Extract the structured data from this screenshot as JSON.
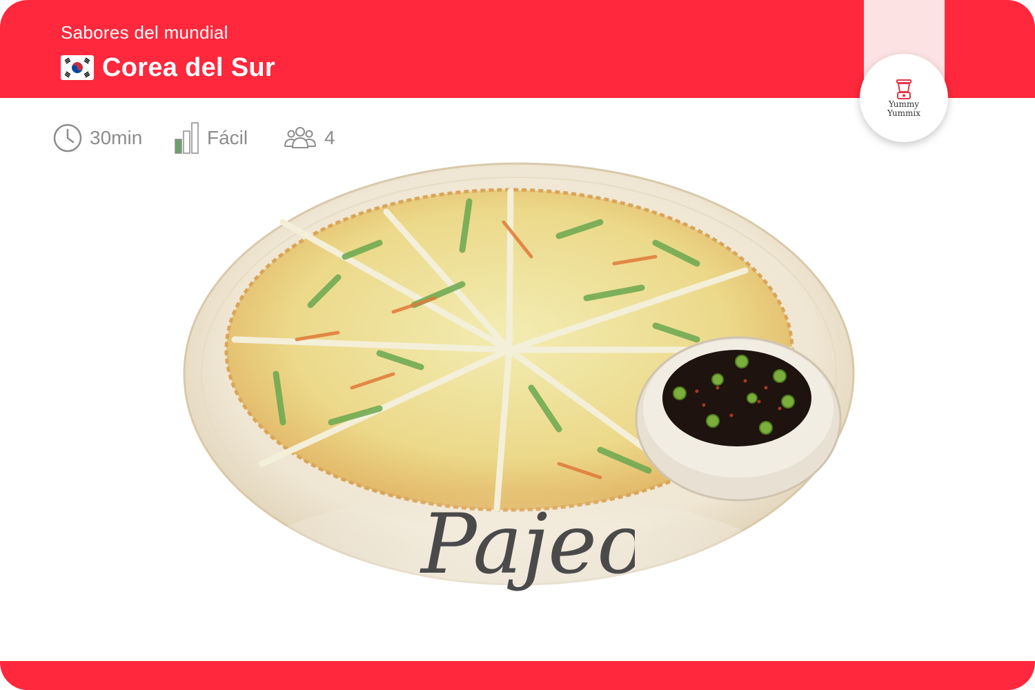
{
  "header": {
    "subtitle": "Sabores del mundial",
    "country": "Corea del Sur",
    "background_color": "#ff283c"
  },
  "brand": {
    "line1": "Yummy",
    "line2": "Yummix",
    "icon": "blender-icon"
  },
  "meta": {
    "time": "30min",
    "difficulty": "Fácil",
    "difficulty_level": 1,
    "difficulty_max": 3,
    "servings": "4"
  },
  "dish": {
    "name": "Pajeon"
  },
  "colors": {
    "accent": "#ff283c",
    "ribbon": "#fde2e3",
    "meta_text": "#8c8c8c",
    "difficulty_fill": "#6aa368"
  }
}
